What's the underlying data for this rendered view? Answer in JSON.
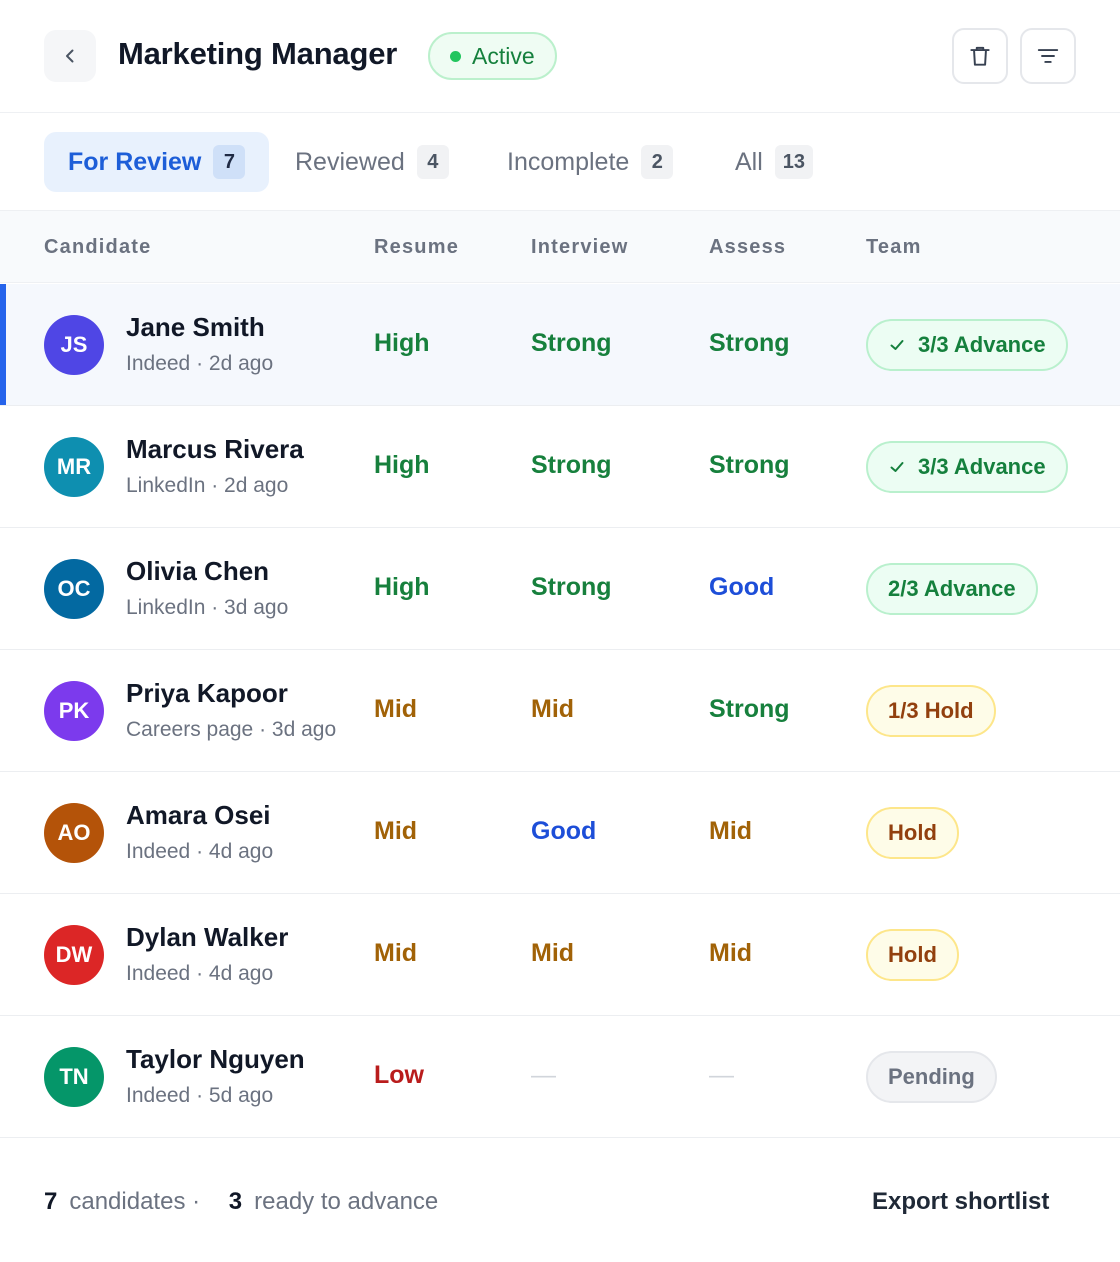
{
  "header": {
    "title": "Marketing Manager",
    "status": "Active"
  },
  "tabs": [
    {
      "label": "For Review",
      "count": "7",
      "active": true
    },
    {
      "label": "Reviewed",
      "count": "4",
      "active": false
    },
    {
      "label": "Incomplete",
      "count": "2",
      "active": false
    },
    {
      "label": "All",
      "count": "13",
      "active": false
    }
  ],
  "columns": {
    "candidate": "Candidate",
    "resume": "Resume",
    "interview": "Interview",
    "assess": "Assess",
    "team": "Team"
  },
  "candidates": [
    {
      "initials": "JS",
      "name": "Jane Smith",
      "meta": "Indeed · 2d ago",
      "avatar_color": "#4f46e5",
      "resume": "High",
      "interview": "Strong",
      "assess": "Strong",
      "team": "3/3 Advance",
      "team_status": "advance",
      "team_check": true,
      "selected": true
    },
    {
      "initials": "MR",
      "name": "Marcus Rivera",
      "meta": "LinkedIn · 2d ago",
      "avatar_color": "#0e8fb0",
      "resume": "High",
      "interview": "Strong",
      "assess": "Strong",
      "team": "3/3 Advance",
      "team_status": "advance",
      "team_check": true,
      "selected": false
    },
    {
      "initials": "OC",
      "name": "Olivia Chen",
      "meta": "LinkedIn · 3d ago",
      "avatar_color": "#0369a1",
      "resume": "High",
      "interview": "Strong",
      "assess": "Good",
      "team": "2/3 Advance",
      "team_status": "advance",
      "team_check": false,
      "selected": false
    },
    {
      "initials": "PK",
      "name": "Priya Kapoor",
      "meta": "Careers page · 3d ago",
      "avatar_color": "#7c3aed",
      "resume": "Mid",
      "interview": "Mid",
      "assess": "Strong",
      "team": "1/3 Hold",
      "team_status": "hold",
      "team_check": false,
      "selected": false
    },
    {
      "initials": "AO",
      "name": "Amara Osei",
      "meta": "Indeed · 4d ago",
      "avatar_color": "#b45309",
      "resume": "Mid",
      "interview": "Good",
      "assess": "Mid",
      "team": "Hold",
      "team_status": "hold",
      "team_check": false,
      "selected": false
    },
    {
      "initials": "DW",
      "name": "Dylan Walker",
      "meta": "Indeed · 4d ago",
      "avatar_color": "#dc2626",
      "resume": "Mid",
      "interview": "Mid",
      "assess": "Mid",
      "team": "Hold",
      "team_status": "hold",
      "team_check": false,
      "selected": false
    },
    {
      "initials": "TN",
      "name": "Taylor Nguyen",
      "meta": "Indeed · 5d ago",
      "avatar_color": "#059669",
      "resume": "Low",
      "interview": "—",
      "assess": "—",
      "team": "Pending",
      "team_status": "pending",
      "team_check": false,
      "selected": false
    }
  ],
  "footer": {
    "count": "7",
    "count_label": "candidates ·",
    "ready": "3",
    "ready_label": "ready to advance",
    "export": "Export shortlist"
  }
}
